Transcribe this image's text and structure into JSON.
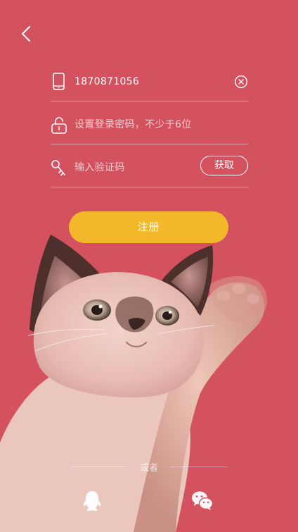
{
  "nav": {
    "back_icon": "chevron-left-icon"
  },
  "form": {
    "phone": {
      "icon": "phone-icon",
      "value": "1870871056",
      "clear_icon": "clear-circle-icon"
    },
    "password": {
      "icon": "unlock-icon",
      "placeholder": "设置登录密码，不少于6位"
    },
    "code": {
      "icon": "key-icon",
      "placeholder": "输入验证码",
      "button_label": "获取"
    }
  },
  "register_label": "注册",
  "divider_text": "或者",
  "social": [
    {
      "icon": "qq-icon"
    },
    {
      "icon": "wechat-icon"
    }
  ],
  "colors": {
    "background": "#d4515f",
    "button": "#f3b829",
    "text": "#ffffff"
  }
}
